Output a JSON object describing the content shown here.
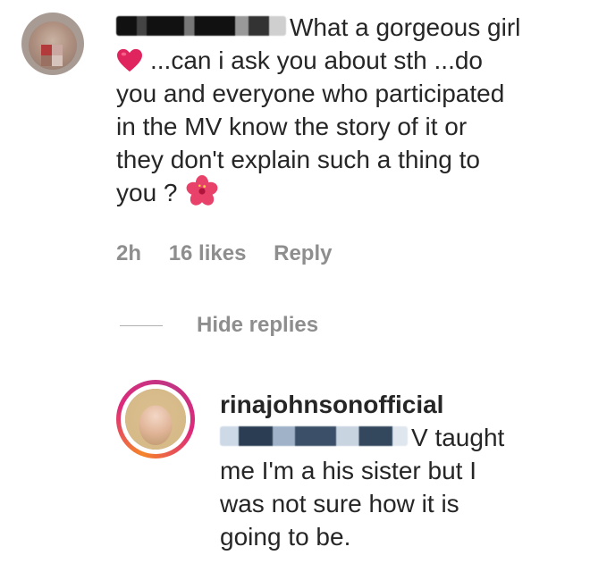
{
  "comment": {
    "avatar_icon": "user-avatar-blurred",
    "text_line1": "What a gorgeous girl",
    "heart_icon": "red-heart-emoji",
    "text_rest_1": "...can i ask you about sth ...do",
    "text_rest_2": "you and everyone who participated",
    "text_rest_3": "in the MV know the story of it or",
    "text_rest_4": "they don't explain such a thing to",
    "text_rest_5": "you ?",
    "flower_icon": "hibiscus-emoji",
    "time": "2h",
    "likes": "16 likes",
    "reply_label": "Reply"
  },
  "replies": {
    "hide_label": "Hide replies",
    "items": [
      {
        "username": "rinajohnsonofficial",
        "text_line1": "V taught",
        "text_line2": "me I'm a his sister but I",
        "text_line3": "was not sure how it is",
        "text_line4": "going to be."
      }
    ]
  },
  "colors": {
    "text": "#262626",
    "meta": "#8e8e8e",
    "heart": "#e0245e",
    "story_ring_start": "#f58529",
    "story_ring_end": "#dd2a7b"
  }
}
